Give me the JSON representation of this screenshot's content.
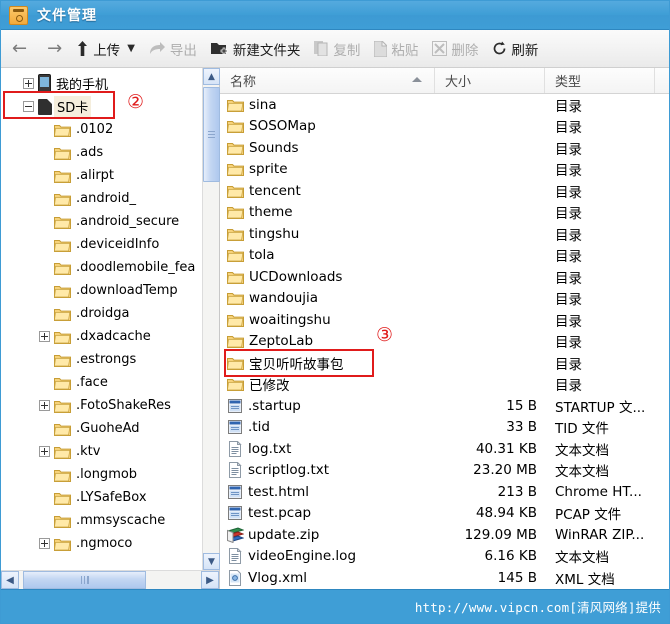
{
  "window": {
    "title": "文件管理",
    "app_icon": "safe-box-icon",
    "accent_color": "#3f9ed6",
    "annotation_color": "#e01b1b"
  },
  "toolbar": {
    "back_icon": "back-arrow-icon",
    "forward_icon": "forward-arrow-icon",
    "items": [
      {
        "label": "上传",
        "icon": "upload-icon",
        "disabled": false,
        "has_caret": true
      },
      {
        "label": "导出",
        "icon": "export-icon",
        "disabled": true,
        "has_caret": false
      },
      {
        "label": "新建文件夹",
        "icon": "new-folder-icon",
        "disabled": false,
        "has_caret": false
      },
      {
        "label": "复制",
        "icon": "copy-icon",
        "disabled": true,
        "has_caret": false
      },
      {
        "label": "粘贴",
        "icon": "paste-icon",
        "disabled": true,
        "has_caret": false
      },
      {
        "label": "删除",
        "icon": "delete-icon",
        "disabled": true,
        "has_caret": false
      },
      {
        "label": "刷新",
        "icon": "refresh-icon",
        "disabled": false,
        "has_caret": false
      }
    ]
  },
  "tree": {
    "nodes": [
      {
        "label": "我的手机",
        "icon": "phone-icon",
        "expander": "plus",
        "indent": 0,
        "selected": false
      },
      {
        "label": "SD卡",
        "icon": "sdcard-icon",
        "expander": "minus",
        "indent": 0,
        "selected": true
      },
      {
        "label": ".0102",
        "icon": "folder-icon",
        "expander": "none",
        "indent": 1,
        "selected": false
      },
      {
        "label": ".ads",
        "icon": "folder-icon",
        "expander": "none",
        "indent": 1,
        "selected": false
      },
      {
        "label": ".alirpt",
        "icon": "folder-icon",
        "expander": "none",
        "indent": 1,
        "selected": false
      },
      {
        "label": ".android_",
        "icon": "folder-icon",
        "expander": "none",
        "indent": 1,
        "selected": false
      },
      {
        "label": ".android_secure",
        "icon": "folder-icon",
        "expander": "none",
        "indent": 1,
        "selected": false
      },
      {
        "label": ".deviceidInfo",
        "icon": "folder-icon",
        "expander": "none",
        "indent": 1,
        "selected": false
      },
      {
        "label": ".doodlemobile_fea",
        "icon": "folder-icon",
        "expander": "none",
        "indent": 1,
        "selected": false
      },
      {
        "label": ".downloadTemp",
        "icon": "folder-icon",
        "expander": "none",
        "indent": 1,
        "selected": false
      },
      {
        "label": ".droidga",
        "icon": "folder-icon",
        "expander": "none",
        "indent": 1,
        "selected": false
      },
      {
        "label": ".dxadcache",
        "icon": "folder-icon",
        "expander": "plus",
        "indent": 1,
        "selected": false
      },
      {
        "label": ".estrongs",
        "icon": "folder-icon",
        "expander": "none",
        "indent": 1,
        "selected": false
      },
      {
        "label": ".face",
        "icon": "folder-icon",
        "expander": "none",
        "indent": 1,
        "selected": false
      },
      {
        "label": ".FotoShakeRes",
        "icon": "folder-icon",
        "expander": "plus",
        "indent": 1,
        "selected": false
      },
      {
        "label": ".GuoheAd",
        "icon": "folder-icon",
        "expander": "none",
        "indent": 1,
        "selected": false
      },
      {
        "label": ".ktv",
        "icon": "folder-icon",
        "expander": "plus",
        "indent": 1,
        "selected": false
      },
      {
        "label": ".longmob",
        "icon": "folder-icon",
        "expander": "none",
        "indent": 1,
        "selected": false
      },
      {
        "label": ".LYSafeBox",
        "icon": "folder-icon",
        "expander": "none",
        "indent": 1,
        "selected": false
      },
      {
        "label": ".mmsyscache",
        "icon": "folder-icon",
        "expander": "none",
        "indent": 1,
        "selected": false
      },
      {
        "label": ".ngmoco",
        "icon": "folder-icon",
        "expander": "plus",
        "indent": 1,
        "selected": false
      }
    ]
  },
  "file_list": {
    "columns": [
      {
        "key": "name",
        "label": "名称",
        "sorted": "asc"
      },
      {
        "key": "size",
        "label": "大小",
        "sorted": ""
      },
      {
        "key": "type",
        "label": "类型",
        "sorted": ""
      }
    ],
    "rows": [
      {
        "name": "sina",
        "size": "",
        "type": "目录",
        "icon": "folder-icon"
      },
      {
        "name": "SOSOMap",
        "size": "",
        "type": "目录",
        "icon": "folder-icon"
      },
      {
        "name": "Sounds",
        "size": "",
        "type": "目录",
        "icon": "folder-icon"
      },
      {
        "name": "sprite",
        "size": "",
        "type": "目录",
        "icon": "folder-icon"
      },
      {
        "name": "tencent",
        "size": "",
        "type": "目录",
        "icon": "folder-icon"
      },
      {
        "name": "theme",
        "size": "",
        "type": "目录",
        "icon": "folder-icon"
      },
      {
        "name": "tingshu",
        "size": "",
        "type": "目录",
        "icon": "folder-icon"
      },
      {
        "name": "tola",
        "size": "",
        "type": "目录",
        "icon": "folder-icon"
      },
      {
        "name": "UCDownloads",
        "size": "",
        "type": "目录",
        "icon": "folder-icon"
      },
      {
        "name": "wandoujia",
        "size": "",
        "type": "目录",
        "icon": "folder-icon"
      },
      {
        "name": "woaitingshu",
        "size": "",
        "type": "目录",
        "icon": "folder-icon"
      },
      {
        "name": "ZeptoLab",
        "size": "",
        "type": "目录",
        "icon": "folder-icon"
      },
      {
        "name": "宝贝听听故事包",
        "size": "",
        "type": "目录",
        "icon": "folder-icon"
      },
      {
        "name": "已修改",
        "size": "",
        "type": "目录",
        "icon": "folder-icon"
      },
      {
        "name": ".startup",
        "size": "15 B",
        "type": "STARTUP 文...",
        "icon": "window-file-icon"
      },
      {
        "name": ".tid",
        "size": "33 B",
        "type": "TID 文件",
        "icon": "window-file-icon"
      },
      {
        "name": "log.txt",
        "size": "40.31 KB",
        "type": "文本文档",
        "icon": "text-doc-icon"
      },
      {
        "name": "scriptlog.txt",
        "size": "23.20 MB",
        "type": "文本文档",
        "icon": "text-doc-icon"
      },
      {
        "name": "test.html",
        "size": "213 B",
        "type": "Chrome HT...",
        "icon": "window-file-icon"
      },
      {
        "name": "test.pcap",
        "size": "48.94 KB",
        "type": "PCAP 文件",
        "icon": "window-file-icon"
      },
      {
        "name": "update.zip",
        "size": "129.09 MB",
        "type": "WinRAR ZIP...",
        "icon": "zip-archive-icon"
      },
      {
        "name": "videoEngine.log",
        "size": "6.16 KB",
        "type": "文本文档",
        "icon": "text-doc-icon"
      },
      {
        "name": "Vlog.xml",
        "size": "145 B",
        "type": "XML 文档",
        "icon": "xml-file-icon"
      }
    ]
  },
  "annotations": [
    {
      "id": "2",
      "label": "②",
      "target": "sdcard-tree-node"
    },
    {
      "id": "3",
      "label": "③",
      "target": "baobei-folder-row"
    }
  ],
  "footer": {
    "watermark": "http://www.vipcn.com[清风网络]提供"
  }
}
